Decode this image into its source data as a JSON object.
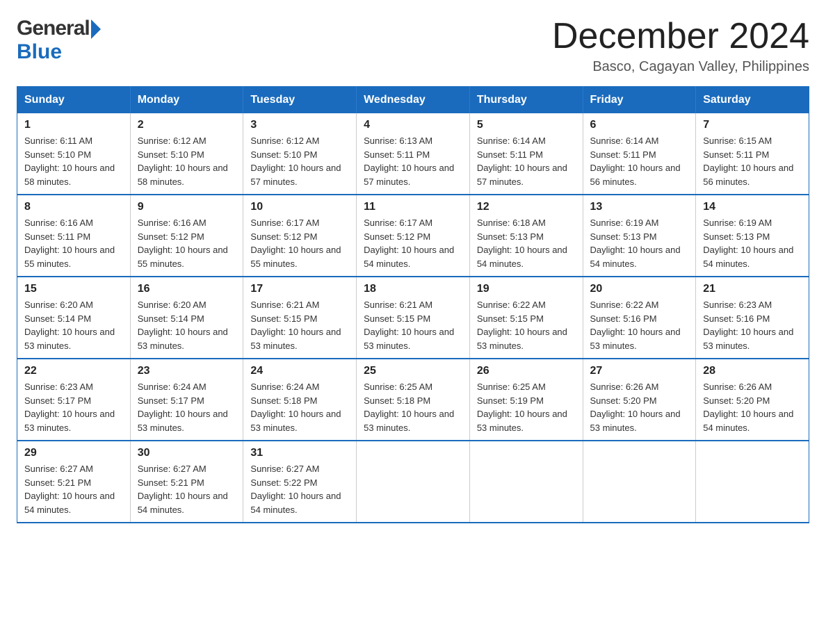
{
  "logo": {
    "general": "General",
    "blue": "Blue",
    "arrow": "▶"
  },
  "title": {
    "month": "December 2024",
    "location": "Basco, Cagayan Valley, Philippines"
  },
  "days_header": [
    "Sunday",
    "Monday",
    "Tuesday",
    "Wednesday",
    "Thursday",
    "Friday",
    "Saturday"
  ],
  "weeks": [
    [
      {
        "day": "1",
        "sunrise": "6:11 AM",
        "sunset": "5:10 PM",
        "daylight": "10 hours and 58 minutes."
      },
      {
        "day": "2",
        "sunrise": "6:12 AM",
        "sunset": "5:10 PM",
        "daylight": "10 hours and 58 minutes."
      },
      {
        "day": "3",
        "sunrise": "6:12 AM",
        "sunset": "5:10 PM",
        "daylight": "10 hours and 57 minutes."
      },
      {
        "day": "4",
        "sunrise": "6:13 AM",
        "sunset": "5:11 PM",
        "daylight": "10 hours and 57 minutes."
      },
      {
        "day": "5",
        "sunrise": "6:14 AM",
        "sunset": "5:11 PM",
        "daylight": "10 hours and 57 minutes."
      },
      {
        "day": "6",
        "sunrise": "6:14 AM",
        "sunset": "5:11 PM",
        "daylight": "10 hours and 56 minutes."
      },
      {
        "day": "7",
        "sunrise": "6:15 AM",
        "sunset": "5:11 PM",
        "daylight": "10 hours and 56 minutes."
      }
    ],
    [
      {
        "day": "8",
        "sunrise": "6:16 AM",
        "sunset": "5:11 PM",
        "daylight": "10 hours and 55 minutes."
      },
      {
        "day": "9",
        "sunrise": "6:16 AM",
        "sunset": "5:12 PM",
        "daylight": "10 hours and 55 minutes."
      },
      {
        "day": "10",
        "sunrise": "6:17 AM",
        "sunset": "5:12 PM",
        "daylight": "10 hours and 55 minutes."
      },
      {
        "day": "11",
        "sunrise": "6:17 AM",
        "sunset": "5:12 PM",
        "daylight": "10 hours and 54 minutes."
      },
      {
        "day": "12",
        "sunrise": "6:18 AM",
        "sunset": "5:13 PM",
        "daylight": "10 hours and 54 minutes."
      },
      {
        "day": "13",
        "sunrise": "6:19 AM",
        "sunset": "5:13 PM",
        "daylight": "10 hours and 54 minutes."
      },
      {
        "day": "14",
        "sunrise": "6:19 AM",
        "sunset": "5:13 PM",
        "daylight": "10 hours and 54 minutes."
      }
    ],
    [
      {
        "day": "15",
        "sunrise": "6:20 AM",
        "sunset": "5:14 PM",
        "daylight": "10 hours and 53 minutes."
      },
      {
        "day": "16",
        "sunrise": "6:20 AM",
        "sunset": "5:14 PM",
        "daylight": "10 hours and 53 minutes."
      },
      {
        "day": "17",
        "sunrise": "6:21 AM",
        "sunset": "5:15 PM",
        "daylight": "10 hours and 53 minutes."
      },
      {
        "day": "18",
        "sunrise": "6:21 AM",
        "sunset": "5:15 PM",
        "daylight": "10 hours and 53 minutes."
      },
      {
        "day": "19",
        "sunrise": "6:22 AM",
        "sunset": "5:15 PM",
        "daylight": "10 hours and 53 minutes."
      },
      {
        "day": "20",
        "sunrise": "6:22 AM",
        "sunset": "5:16 PM",
        "daylight": "10 hours and 53 minutes."
      },
      {
        "day": "21",
        "sunrise": "6:23 AM",
        "sunset": "5:16 PM",
        "daylight": "10 hours and 53 minutes."
      }
    ],
    [
      {
        "day": "22",
        "sunrise": "6:23 AM",
        "sunset": "5:17 PM",
        "daylight": "10 hours and 53 minutes."
      },
      {
        "day": "23",
        "sunrise": "6:24 AM",
        "sunset": "5:17 PM",
        "daylight": "10 hours and 53 minutes."
      },
      {
        "day": "24",
        "sunrise": "6:24 AM",
        "sunset": "5:18 PM",
        "daylight": "10 hours and 53 minutes."
      },
      {
        "day": "25",
        "sunrise": "6:25 AM",
        "sunset": "5:18 PM",
        "daylight": "10 hours and 53 minutes."
      },
      {
        "day": "26",
        "sunrise": "6:25 AM",
        "sunset": "5:19 PM",
        "daylight": "10 hours and 53 minutes."
      },
      {
        "day": "27",
        "sunrise": "6:26 AM",
        "sunset": "5:20 PM",
        "daylight": "10 hours and 53 minutes."
      },
      {
        "day": "28",
        "sunrise": "6:26 AM",
        "sunset": "5:20 PM",
        "daylight": "10 hours and 54 minutes."
      }
    ],
    [
      {
        "day": "29",
        "sunrise": "6:27 AM",
        "sunset": "5:21 PM",
        "daylight": "10 hours and 54 minutes."
      },
      {
        "day": "30",
        "sunrise": "6:27 AM",
        "sunset": "5:21 PM",
        "daylight": "10 hours and 54 minutes."
      },
      {
        "day": "31",
        "sunrise": "6:27 AM",
        "sunset": "5:22 PM",
        "daylight": "10 hours and 54 minutes."
      },
      null,
      null,
      null,
      null
    ]
  ],
  "cell_labels": {
    "sunrise": "Sunrise:",
    "sunset": "Sunset:",
    "daylight": "Daylight:"
  }
}
